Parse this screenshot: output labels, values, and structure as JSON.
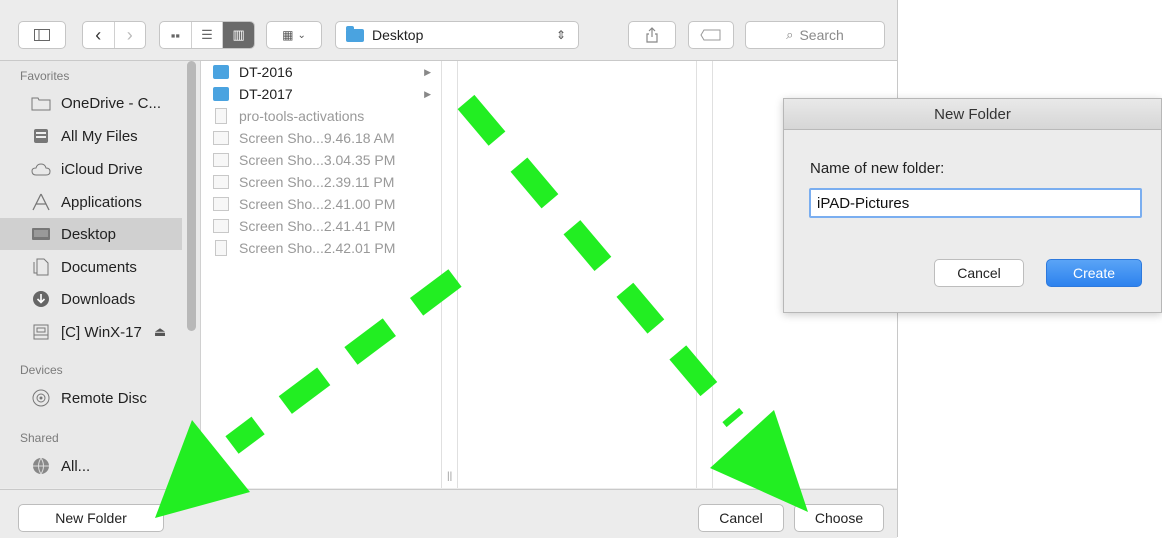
{
  "toolbar": {
    "location": "Desktop",
    "search_placeholder": "Search"
  },
  "sidebar": {
    "favorites_heading": "Favorites",
    "favorites": [
      {
        "label": "OneDrive - C...",
        "icon": "folder-icon"
      },
      {
        "label": "All My Files",
        "icon": "all-files-icon"
      },
      {
        "label": "iCloud Drive",
        "icon": "cloud-icon"
      },
      {
        "label": "Applications",
        "icon": "applications-icon"
      },
      {
        "label": "Desktop",
        "icon": "desktop-icon",
        "selected": true
      },
      {
        "label": "Documents",
        "icon": "documents-icon"
      },
      {
        "label": "Downloads",
        "icon": "download-icon"
      },
      {
        "label": "[C] WinX-17",
        "icon": "disk-icon",
        "eject": "⏏"
      }
    ],
    "devices_heading": "Devices",
    "devices": [
      {
        "label": "Remote Disc",
        "icon": "disc-icon"
      }
    ],
    "shared_heading": "Shared",
    "shared": [
      {
        "label": "All...",
        "icon": "network-icon"
      }
    ]
  },
  "files": [
    {
      "name": "DT-2016",
      "type": "folder"
    },
    {
      "name": "DT-2017",
      "type": "folder"
    },
    {
      "name": "pro-tools-activations",
      "type": "document"
    },
    {
      "name": "Screen Sho...9.46.18 AM",
      "type": "image"
    },
    {
      "name": "Screen Sho...3.04.35 PM",
      "type": "image"
    },
    {
      "name": "Screen Sho...2.39.11 PM",
      "type": "image"
    },
    {
      "name": "Screen Sho...2.41.00 PM",
      "type": "image"
    },
    {
      "name": "Screen Sho...2.41.41 PM",
      "type": "image"
    },
    {
      "name": "Screen Sho...2.42.01 PM",
      "type": "image"
    }
  ],
  "bottom": {
    "new_folder": "New Folder",
    "cancel": "Cancel",
    "choose": "Choose"
  },
  "new_folder_dialog": {
    "title": "New Folder",
    "label": "Name of new folder:",
    "value": "iPAD-Pictures",
    "cancel": "Cancel",
    "create": "Create"
  },
  "colors": {
    "arrow": "#22ee22",
    "accent": "#2d82ee",
    "folder": "#4aa3e0"
  }
}
